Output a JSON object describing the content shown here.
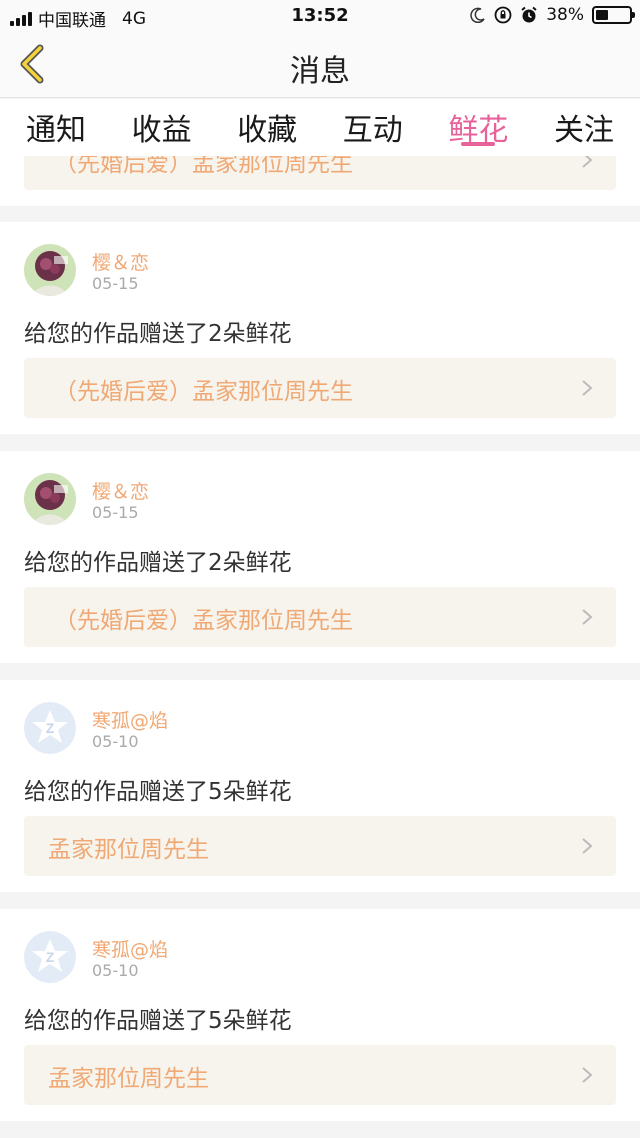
{
  "status_bar": {
    "carrier": "中国联通",
    "network": "4G",
    "time": "13:52",
    "battery_percent": "38%",
    "battery_level": 0.38
  },
  "header": {
    "title": "消息"
  },
  "tabs": [
    {
      "label": "通知",
      "active": false
    },
    {
      "label": "收益",
      "active": false
    },
    {
      "label": "收藏",
      "active": false
    },
    {
      "label": "互动",
      "active": false
    },
    {
      "label": "鲜花",
      "active": true
    },
    {
      "label": "关注",
      "active": false
    }
  ],
  "colors": {
    "accent_pink": "#e8629a",
    "orange_text": "#f0a874",
    "work_bg": "#f6f4ec"
  },
  "partial_top_card": {
    "work_title": "（先婚后爱）孟家那位周先生"
  },
  "messages": [
    {
      "username": "樱＆恋",
      "date": "05-15",
      "avatar": "photo-avatar",
      "text": "给您的作品赠送了2朵鲜花",
      "work_title": "（先婚后爱）孟家那位周先生"
    },
    {
      "username": "樱＆恋",
      "date": "05-15",
      "avatar": "photo-avatar",
      "text": "给您的作品赠送了2朵鲜花",
      "work_title": "（先婚后爱）孟家那位周先生"
    },
    {
      "username": "寒孤@焰",
      "date": "05-10",
      "avatar": "default-avatar",
      "text": "给您的作品赠送了5朵鲜花",
      "work_title": "孟家那位周先生"
    },
    {
      "username": "寒孤@焰",
      "date": "05-10",
      "avatar": "default-avatar",
      "text": "给您的作品赠送了5朵鲜花",
      "work_title": "孟家那位周先生"
    }
  ]
}
